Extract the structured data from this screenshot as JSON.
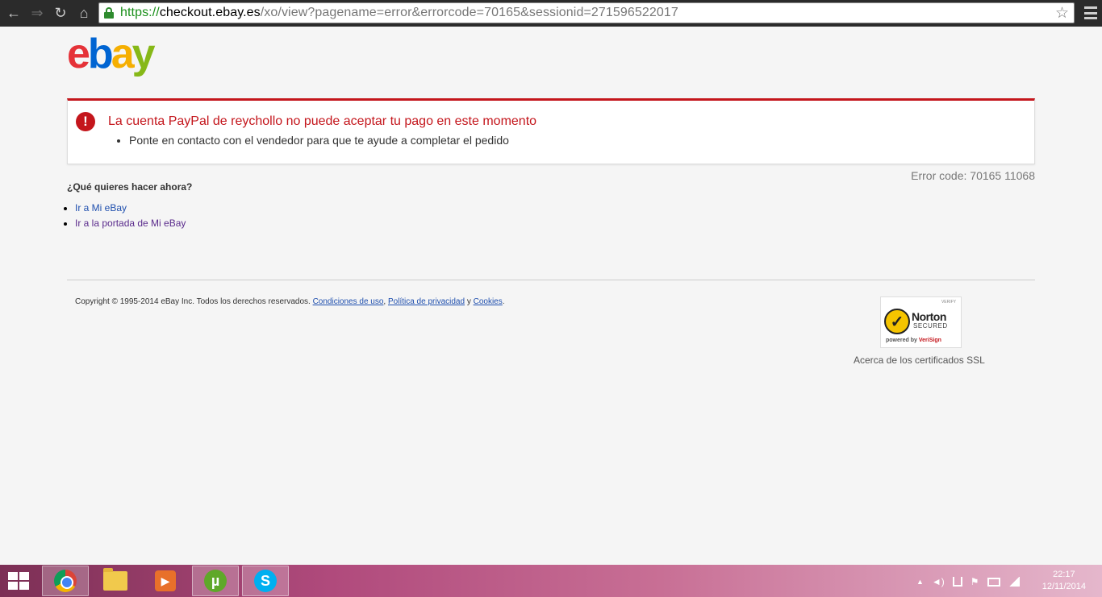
{
  "browser": {
    "url_scheme": "https://",
    "url_host": "checkout.ebay.es",
    "url_path": "/xo/view?pagename=error&errorcode=70165&sessionid=271596522017",
    "back_icon": "←",
    "forward_icon": "⇒",
    "reload_icon": "↻",
    "home_icon": "⌂",
    "star_icon": "☆"
  },
  "logo": {
    "e": "e",
    "b": "b",
    "a": "a",
    "y": "y"
  },
  "alert": {
    "icon": "!",
    "title": "La cuenta PayPal de reychollo no puede aceptar tu pago en este momento",
    "items": [
      "Ponte en contacto con el vendedor para que te ayude a completar el pedido"
    ]
  },
  "error_code": "Error code: 70165 11068",
  "question": "¿Qué quieres hacer ahora?",
  "links": [
    {
      "label": "Ir a Mi eBay"
    },
    {
      "label": "Ir a la portada de Mi eBay"
    }
  ],
  "footer": {
    "copyright": "Copyright © 1995-2014 eBay Inc. Todos los derechos reservados.",
    "terms": "Condiciones de uso",
    "sep1": ",",
    "privacy": "Política de privacidad",
    "and": "y",
    "cookies": "Cookies",
    "end": "."
  },
  "norton": {
    "verify": "VERIFY",
    "name": "Norton",
    "secured": "SECURED",
    "powered": "powered by",
    "verisign": "VeriSign",
    "check": "✓",
    "ssl_label": "Acerca de los certificados SSL"
  },
  "taskbar": {
    "time": "22:17",
    "date": "12/11/2014",
    "utorrent_glyph": "µ",
    "skype_glyph": "S",
    "media_glyph": "▶",
    "tray": {
      "up_arrow": "▲",
      "volume": "◄)",
      "flag": "⚑"
    }
  }
}
